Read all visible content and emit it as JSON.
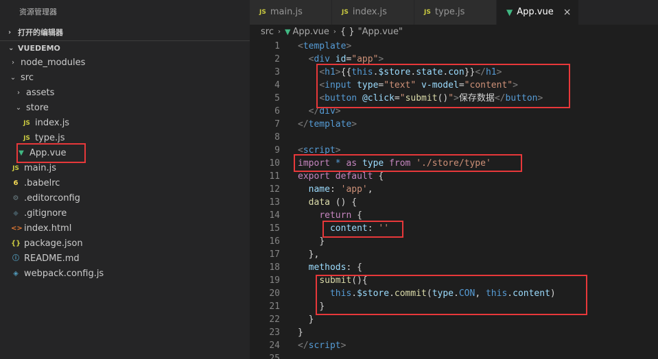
{
  "sidebar": {
    "title": "资源管理器",
    "open_editors": "打开的编辑器",
    "project": "VUEDEMO",
    "items": [
      {
        "label": "node_modules",
        "type": "folder",
        "chevron": "›",
        "icon": ""
      },
      {
        "label": "src",
        "type": "folder",
        "chevron": "⌄",
        "icon": ""
      },
      {
        "label": "assets",
        "type": "folder",
        "chevron": "›",
        "icon": ""
      },
      {
        "label": "store",
        "type": "folder",
        "chevron": "⌄",
        "icon": ""
      },
      {
        "label": "index.js",
        "type": "js",
        "icon": "JS"
      },
      {
        "label": "type.js",
        "type": "js",
        "icon": "JS"
      },
      {
        "label": "App.vue",
        "type": "vue",
        "icon": "▼"
      },
      {
        "label": "main.js",
        "type": "js",
        "icon": "JS"
      },
      {
        "label": ".babelrc",
        "type": "babel",
        "icon": "6"
      },
      {
        "label": ".editorconfig",
        "type": "gear",
        "icon": "⚙"
      },
      {
        "label": ".gitignore",
        "type": "git",
        "icon": "◆"
      },
      {
        "label": "index.html",
        "type": "html",
        "icon": "<>"
      },
      {
        "label": "package.json",
        "type": "json",
        "icon": "{}"
      },
      {
        "label": "README.md",
        "type": "info",
        "icon": "ⓘ"
      },
      {
        "label": "webpack.config.js",
        "type": "webpack",
        "icon": "◈"
      }
    ]
  },
  "tabs": [
    {
      "label": "main.js",
      "icon": "JS"
    },
    {
      "label": "index.js",
      "icon": "JS"
    },
    {
      "label": "type.js",
      "icon": "JS"
    },
    {
      "label": "App.vue",
      "icon": "▼",
      "close": "×"
    }
  ],
  "breadcrumb": {
    "folder": "src",
    "file": "App.vue",
    "symbol_icon": "{ }",
    "symbol": "\"App.vue\""
  },
  "code": {
    "line_numbers": [
      "1",
      "2",
      "3",
      "4",
      "5",
      "6",
      "7",
      "8",
      "9",
      "10",
      "11",
      "12",
      "13",
      "14",
      "15",
      "16",
      "17",
      "18",
      "19",
      "20",
      "21",
      "22",
      "23",
      "24",
      "25"
    ]
  },
  "colors": {
    "highlight_box": "#e8383a",
    "vue_green": "#41b883",
    "js_yellow": "#cbcb41"
  }
}
